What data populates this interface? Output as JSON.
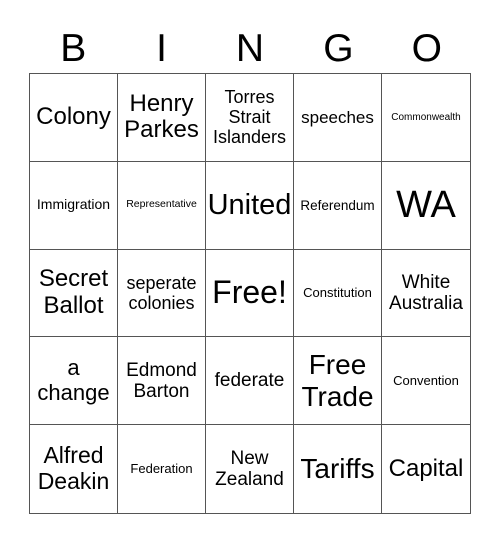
{
  "header": {
    "letters": [
      "B",
      "I",
      "N",
      "G",
      "O"
    ]
  },
  "card": {
    "cells": [
      "Colony",
      "Henry Parkes",
      "Torres Strait Islanders",
      "speeches",
      "Commonwealth",
      "Immigration",
      "Representative",
      "United",
      "Referendum",
      "WA",
      "Secret Ballot",
      "seperate colonies",
      "Free!",
      "Constitution",
      "White Australia",
      "a change",
      "Edmond Barton",
      "federate",
      "Free Trade",
      "Convention",
      "Alfred Deakin",
      "Federation",
      "New Zealand",
      "Tariffs",
      "Capital"
    ]
  }
}
